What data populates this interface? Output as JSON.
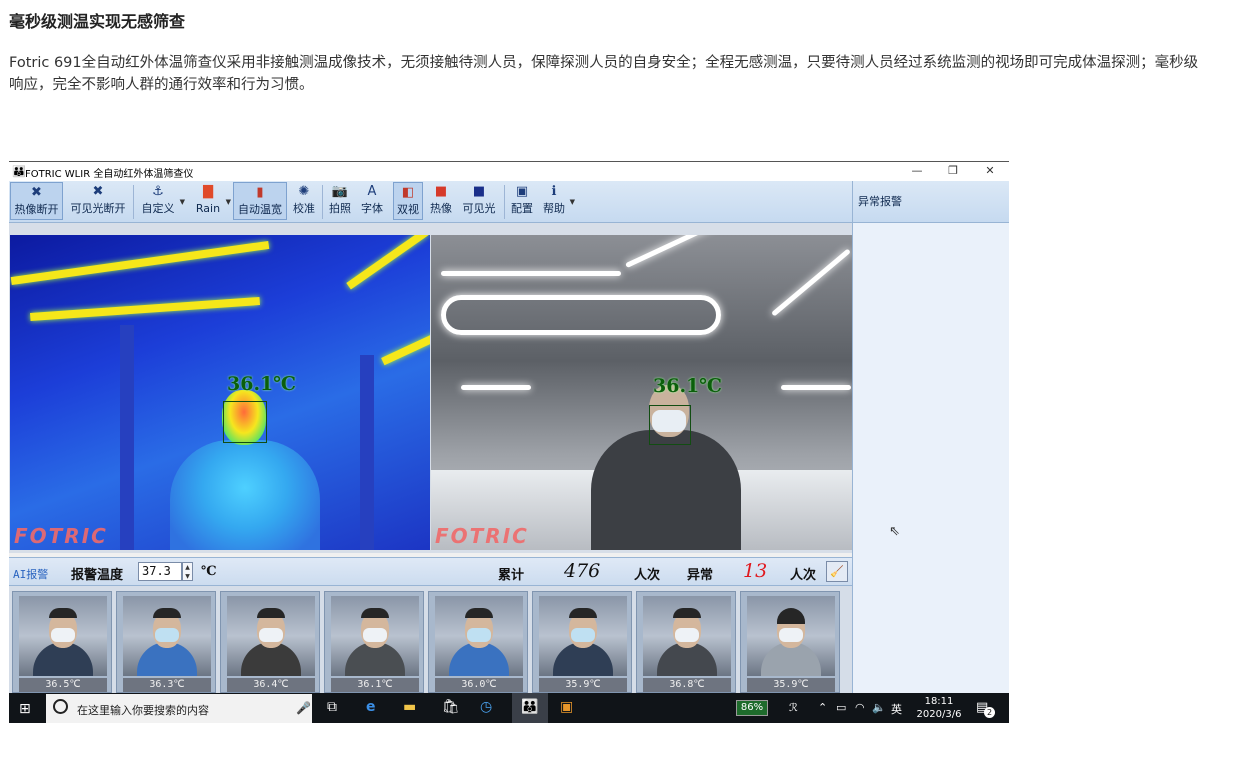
{
  "article": {
    "title": "毫秒级测温实现无感筛查",
    "description": "Fotric 691全自动红外体温筛查仪采用非接触测温成像技术，无须接触待测人员，保障探测人员的自身安全；全程无感测温，只要待测人员经过系统监测的视场即可完成体温探测；毫秒级响应，完全不影响人群的通行效率和行为习惯。"
  },
  "window": {
    "title": "FOTRIC WLIR 全自动红外体温筛查仪",
    "minimize": "—",
    "restore": "❐",
    "close": "✕"
  },
  "toolbar": {
    "items": [
      {
        "label": "热像断开",
        "icon": "✖"
      },
      {
        "label": "可见光断开",
        "icon": "✖"
      },
      {
        "label": "自定义",
        "icon": "⚓"
      },
      {
        "label": "Rain",
        "icon": "▇"
      },
      {
        "label": "自动温宽",
        "icon": "▮"
      },
      {
        "label": "校准",
        "icon": "✺"
      },
      {
        "label": "拍照",
        "icon": "📷"
      },
      {
        "label": "字体",
        "icon": "A"
      },
      {
        "label": "双视",
        "icon": "◧"
      },
      {
        "label": "热像",
        "icon": "■"
      },
      {
        "label": "可见光",
        "icon": "■"
      },
      {
        "label": "配置",
        "icon": "▣"
      },
      {
        "label": "帮助",
        "icon": "ℹ"
      }
    ]
  },
  "side_panel": {
    "title": "异常报警"
  },
  "video": {
    "thermal_temp": "36.1℃",
    "visible_temp": "36.1℃",
    "brand": "FOTRIC"
  },
  "status": {
    "ai_label": "AI报警",
    "alarm_temp_label": "报警温度",
    "alarm_temp_value": "37.3",
    "unit": "℃",
    "total_label": "累计",
    "total_value": "476",
    "count_unit": "人次",
    "abnormal_label": "异常",
    "abnormal_value": "13",
    "count_unit2": "人次"
  },
  "thumbnails": [
    {
      "temp": "36.5℃"
    },
    {
      "temp": "36.3℃"
    },
    {
      "temp": "36.4℃"
    },
    {
      "temp": "36.1℃"
    },
    {
      "temp": "36.0℃"
    },
    {
      "temp": "35.9℃"
    },
    {
      "temp": "36.8℃"
    },
    {
      "temp": "35.9℃"
    }
  ],
  "taskbar": {
    "search_placeholder": "在这里输入你要搜索的内容",
    "battery": "86%",
    "ime": "英",
    "time": "18:11",
    "date": "2020/3/6",
    "notification_count": "2"
  },
  "colors": {
    "accent": "#2a64c0",
    "abnormal": "#e0191f",
    "toolbar_bg": "#c6daf0"
  }
}
